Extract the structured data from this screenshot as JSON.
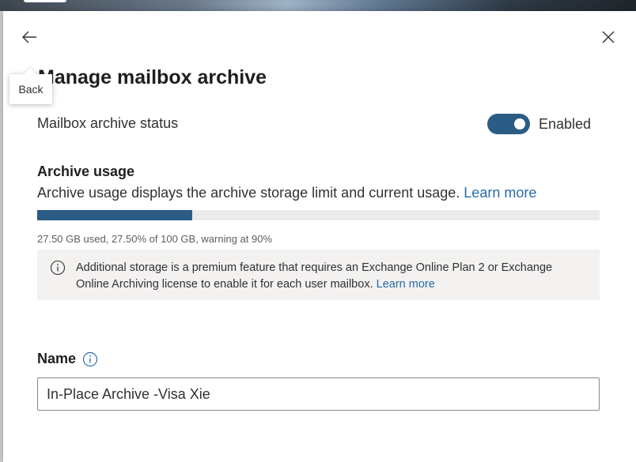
{
  "panel": {
    "back_tooltip": "Back",
    "title": "Manage mailbox archive"
  },
  "status": {
    "label": "Mailbox archive status",
    "toggle_state": "Enabled",
    "enabled": true
  },
  "usage": {
    "heading": "Archive usage",
    "description": "Archive usage displays the archive storage limit and current usage.",
    "learn_more": "Learn more",
    "used_percent": 27.5,
    "summary": "27.50 GB used, 27.50% of 100 GB, warning at 90%"
  },
  "info": {
    "text": "Additional storage is a premium feature that requires an Exchange Online Plan 2 or Exchange Online Archiving license to enable it for each user mailbox.",
    "learn_more": "Learn more"
  },
  "name_field": {
    "label": "Name",
    "value": "In-Place Archive -Visa Xie"
  },
  "icons": {
    "back": "arrow-left-icon",
    "close": "close-icon",
    "info": "info-icon"
  },
  "colors": {
    "accent": "#2b5c86",
    "link": "#2a6aa8",
    "info_background": "#f3f2f1"
  }
}
